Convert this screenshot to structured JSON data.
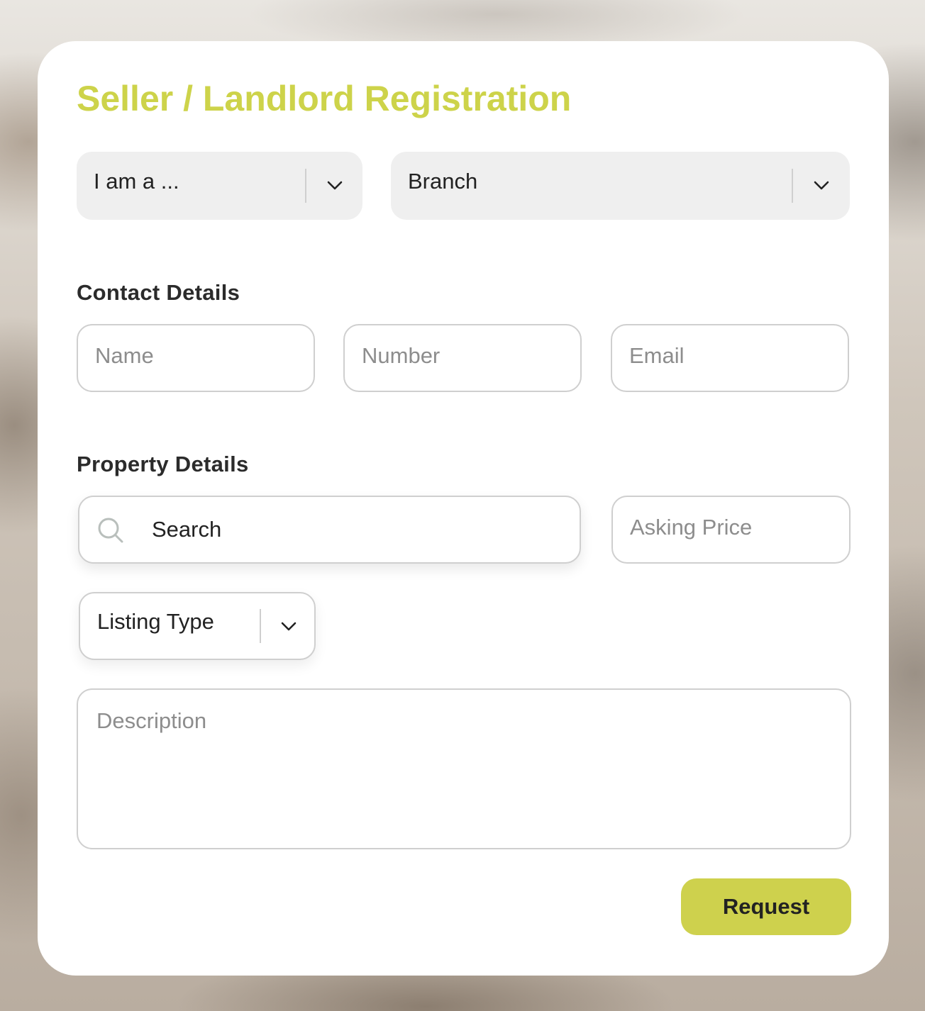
{
  "form": {
    "title": "Seller / Landlord Registration",
    "role_select": {
      "value": "I am a ..."
    },
    "branch_select": {
      "value": "Branch"
    },
    "contact_section_label": "Contact Details",
    "contact_fields": {
      "name_placeholder": "Name",
      "number_placeholder": "Number",
      "email_placeholder": "Email"
    },
    "property_section_label": "Property Details",
    "property_fields": {
      "search_placeholder": "Search",
      "asking_price_placeholder": "Asking Price",
      "listing_type_value": "Listing Type",
      "description_placeholder": "Description"
    },
    "submit_label": "Request"
  },
  "colors": {
    "accent": "#cdd34a",
    "button": "#ced14d",
    "select_bg": "#efefef",
    "border": "#cfcfcf"
  },
  "icons": {
    "search": "search-icon",
    "dropdown": "chevron-down-icon"
  }
}
